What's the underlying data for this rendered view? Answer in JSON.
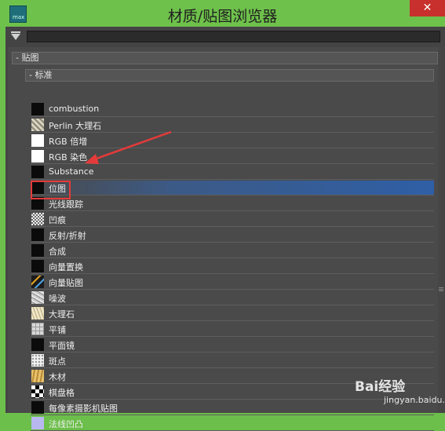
{
  "window": {
    "title": "材质/贴图浏览器",
    "app_icon_text": "max",
    "close_glyph": "✕"
  },
  "search": {
    "value": "",
    "placeholder": ""
  },
  "tree": {
    "group_label": "- 贴图",
    "subgroup_label": "- 标准",
    "items": [
      {
        "label": "combustion",
        "icon": "black-swatch"
      },
      {
        "label": "Perlin 大理石",
        "icon": "perlin-marble-swatch"
      },
      {
        "label": "RGB 倍增",
        "icon": "white-swatch"
      },
      {
        "label": "RGB 染色",
        "icon": "white-swatch"
      },
      {
        "label": "Substance",
        "icon": "black-swatch"
      },
      {
        "label": "位图",
        "icon": "black-swatch",
        "selected": true
      },
      {
        "label": "光线跟踪",
        "icon": "black-swatch"
      },
      {
        "label": "凹痕",
        "icon": "dent-swatch"
      },
      {
        "label": "反射/折射",
        "icon": "black-swatch"
      },
      {
        "label": "合成",
        "icon": "black-swatch"
      },
      {
        "label": "向量置换",
        "icon": "black-swatch"
      },
      {
        "label": "向量贴图",
        "icon": "vector-map-swatch"
      },
      {
        "label": "噪波",
        "icon": "noise-swatch"
      },
      {
        "label": "大理石",
        "icon": "marble-swatch"
      },
      {
        "label": "平铺",
        "icon": "tiles-swatch"
      },
      {
        "label": "平面镜",
        "icon": "black-swatch"
      },
      {
        "label": "斑点",
        "icon": "speckle-swatch"
      },
      {
        "label": "木材",
        "icon": "wood-swatch"
      },
      {
        "label": "棋盘格",
        "icon": "checker-swatch"
      },
      {
        "label": "每像素摄影机贴图",
        "icon": "black-swatch"
      },
      {
        "label": "法线凹凸",
        "icon": "normal-bump-swatch"
      }
    ]
  },
  "watermark": {
    "brand": "Bai经验",
    "url": "jingyan.baidu.com"
  },
  "colors": {
    "titlebar": "#6ec14b",
    "panel": "#444444",
    "selection": "#2f5fa6",
    "annotation": "#e43a3a"
  }
}
